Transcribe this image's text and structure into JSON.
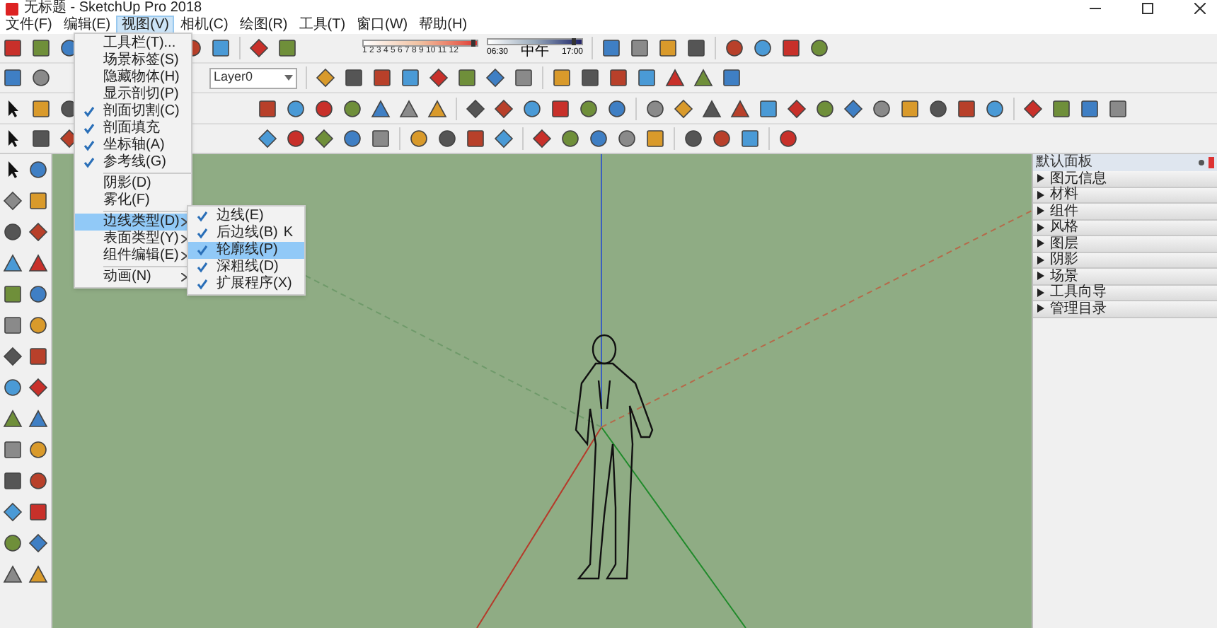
{
  "window": {
    "title": "无标题 - SketchUp Pro 2018"
  },
  "menu_bar": [
    {
      "label": "文件(F)",
      "selected": false
    },
    {
      "label": "编辑(E)",
      "selected": false
    },
    {
      "label": "视图(V)",
      "selected": true
    },
    {
      "label": "相机(C)",
      "selected": false
    },
    {
      "label": "绘图(R)",
      "selected": false
    },
    {
      "label": "工具(T)",
      "selected": false
    },
    {
      "label": "窗口(W)",
      "selected": false
    },
    {
      "label": "帮助(H)",
      "selected": false
    }
  ],
  "shadow_toolbar": {
    "month_slider": {
      "level": 0.95
    },
    "time_slider": {
      "level": 0.9
    },
    "months": "1 2 3 4 5 6 7 8 9 10 11 12",
    "time_start": "06:30",
    "time_mid": "中午",
    "time_end": "17:00"
  },
  "layer_dropdown": {
    "value": "Layer0"
  },
  "view_menu": [
    {
      "kind": "item",
      "label": "工具栏(T)...",
      "checked": false,
      "submenu": false,
      "selected": false
    },
    {
      "kind": "item",
      "label": "场景标签(S)",
      "checked": false,
      "submenu": false,
      "selected": false
    },
    {
      "kind": "item",
      "label": "隐藏物体(H)",
      "checked": false,
      "submenu": false,
      "selected": false
    },
    {
      "kind": "item",
      "label": "显示剖切(P)",
      "checked": false,
      "submenu": false,
      "selected": false
    },
    {
      "kind": "item",
      "label": "剖面切割(C)",
      "checked": true,
      "submenu": false,
      "selected": false
    },
    {
      "kind": "item",
      "label": "剖面填充",
      "checked": true,
      "submenu": false,
      "selected": false
    },
    {
      "kind": "item",
      "label": "坐标轴(A)",
      "checked": true,
      "submenu": false,
      "selected": false
    },
    {
      "kind": "item",
      "label": "参考线(G)",
      "checked": true,
      "submenu": false,
      "selected": false
    },
    {
      "kind": "separator"
    },
    {
      "kind": "item",
      "label": "阴影(D)",
      "checked": false,
      "submenu": false,
      "selected": false
    },
    {
      "kind": "item",
      "label": "雾化(F)",
      "checked": false,
      "submenu": false,
      "selected": false
    },
    {
      "kind": "separator"
    },
    {
      "kind": "item",
      "label": "边线类型(D)",
      "checked": false,
      "submenu": true,
      "selected": true
    },
    {
      "kind": "item",
      "label": "表面类型(Y)",
      "checked": false,
      "submenu": true,
      "selected": false
    },
    {
      "kind": "item",
      "label": "组件编辑(E)",
      "checked": false,
      "submenu": true,
      "selected": false
    },
    {
      "kind": "separator"
    },
    {
      "kind": "item",
      "label": "动画(N)",
      "checked": false,
      "submenu": true,
      "selected": false
    }
  ],
  "edge_submenu": [
    {
      "label": "边线(E)",
      "checked": true,
      "selected": false
    },
    {
      "label": "后边线(B)",
      "checked": true,
      "selected": false,
      "shortcut": "K"
    },
    {
      "label": "轮廓线(P)",
      "checked": true,
      "selected": true
    },
    {
      "label": "深粗线(D)",
      "checked": true,
      "selected": false
    },
    {
      "label": "扩展程序(X)",
      "checked": true,
      "selected": false
    }
  ],
  "tray": {
    "title": "默认面板",
    "items": [
      {
        "label": "图元信息",
        "expanded": false
      },
      {
        "label": "材料",
        "expanded": false
      },
      {
        "label": "组件",
        "expanded": false
      },
      {
        "label": "风格",
        "expanded": false
      },
      {
        "label": "图层",
        "expanded": false
      },
      {
        "label": "阴影",
        "expanded": false
      },
      {
        "label": "场景",
        "expanded": false
      },
      {
        "label": "工具向导",
        "expanded": false
      },
      {
        "label": "管理目录",
        "expanded": false
      }
    ]
  }
}
